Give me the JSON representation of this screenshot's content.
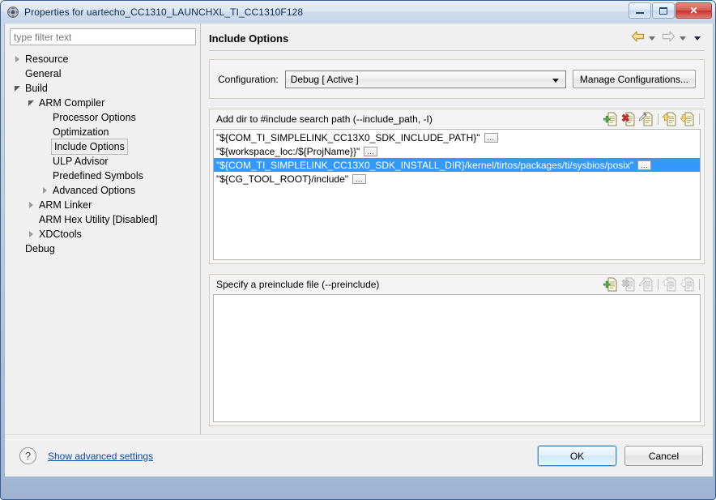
{
  "window": {
    "title": "Properties for uartecho_CC1310_LAUNCHXL_TI_CC1310F128",
    "app_icon": "properties-gear-icon",
    "minimize_label": "Minimize",
    "maximize_label": "Maximize",
    "close_label": "✕"
  },
  "sidebar": {
    "filter": {
      "value": "",
      "placeholder": "type filter text"
    },
    "items": [
      {
        "label": "Resource",
        "indent": 0,
        "arrow": "collapsed",
        "selected": false
      },
      {
        "label": "General",
        "indent": 0,
        "arrow": "none",
        "selected": false
      },
      {
        "label": "Build",
        "indent": 0,
        "arrow": "expanded",
        "selected": false
      },
      {
        "label": "ARM Compiler",
        "indent": 1,
        "arrow": "expanded",
        "selected": false
      },
      {
        "label": "Processor Options",
        "indent": 2,
        "arrow": "none",
        "selected": false
      },
      {
        "label": "Optimization",
        "indent": 2,
        "arrow": "none",
        "selected": false
      },
      {
        "label": "Include Options",
        "indent": 2,
        "arrow": "none",
        "selected": true
      },
      {
        "label": "ULP Advisor",
        "indent": 2,
        "arrow": "none",
        "selected": false
      },
      {
        "label": "Predefined Symbols",
        "indent": 2,
        "arrow": "none",
        "selected": false
      },
      {
        "label": "Advanced Options",
        "indent": 2,
        "arrow": "collapsed",
        "selected": false
      },
      {
        "label": "ARM Linker",
        "indent": 1,
        "arrow": "collapsed",
        "selected": false
      },
      {
        "label": "ARM Hex Utility  [Disabled]",
        "indent": 1,
        "arrow": "none",
        "selected": false
      },
      {
        "label": "XDCtools",
        "indent": 1,
        "arrow": "collapsed",
        "selected": false
      },
      {
        "label": "Debug",
        "indent": 0,
        "arrow": "none",
        "selected": false
      }
    ]
  },
  "page": {
    "title": "Include Options",
    "nav": {
      "back_icon": "back-arrow-icon",
      "back_caret_icon": "chevron-down-icon",
      "forward_icon": "forward-arrow-icon",
      "forward_caret_icon": "chevron-down-icon",
      "menu_caret_icon": "chevron-down-icon"
    }
  },
  "configuration": {
    "label": "Configuration:",
    "value": "Debug  [ Active ]",
    "manage_button": "Manage Configurations..."
  },
  "include_paths": {
    "title": "Add dir to #include search path (--include_path, -I)",
    "tools": [
      {
        "name": "add-icon",
        "enabled": true
      },
      {
        "name": "delete-icon",
        "enabled": true
      },
      {
        "name": "edit-icon",
        "enabled": true
      },
      {
        "name": "move-up-icon",
        "enabled": true
      },
      {
        "name": "move-down-icon",
        "enabled": true
      }
    ],
    "rows": [
      {
        "text": "\"${COM_TI_SIMPLELINK_CC13X0_SDK_INCLUDE_PATH}\"",
        "browse": "...",
        "selected": false
      },
      {
        "text": "\"${workspace_loc:/${ProjName}}\"",
        "browse": "...",
        "selected": false
      },
      {
        "text": "\"${COM_TI_SIMPLELINK_CC13X0_SDK_INSTALL_DIR}/kernel/tirtos/packages/ti/sysbios/posix\"",
        "browse": "...",
        "selected": true
      },
      {
        "text": "\"${CG_TOOL_ROOT}/include\"",
        "browse": "...",
        "selected": false
      }
    ]
  },
  "preinclude": {
    "title": "Specify a preinclude file (--preinclude)",
    "tools": [
      {
        "name": "add-icon",
        "enabled": true
      },
      {
        "name": "delete-icon",
        "enabled": false
      },
      {
        "name": "edit-icon",
        "enabled": false
      },
      {
        "name": "move-up-icon",
        "enabled": false
      },
      {
        "name": "move-down-icon",
        "enabled": false
      }
    ],
    "rows": []
  },
  "footer": {
    "help_icon": "help-icon",
    "help_glyph": "?",
    "advanced_link": "Show advanced settings",
    "ok_label": "OK",
    "cancel_label": "Cancel"
  },
  "colors": {
    "selection_blue": "#3399ff",
    "link_blue": "#0b49a8",
    "title_blue": "#0b2a50",
    "close_red": "#c2342c"
  }
}
